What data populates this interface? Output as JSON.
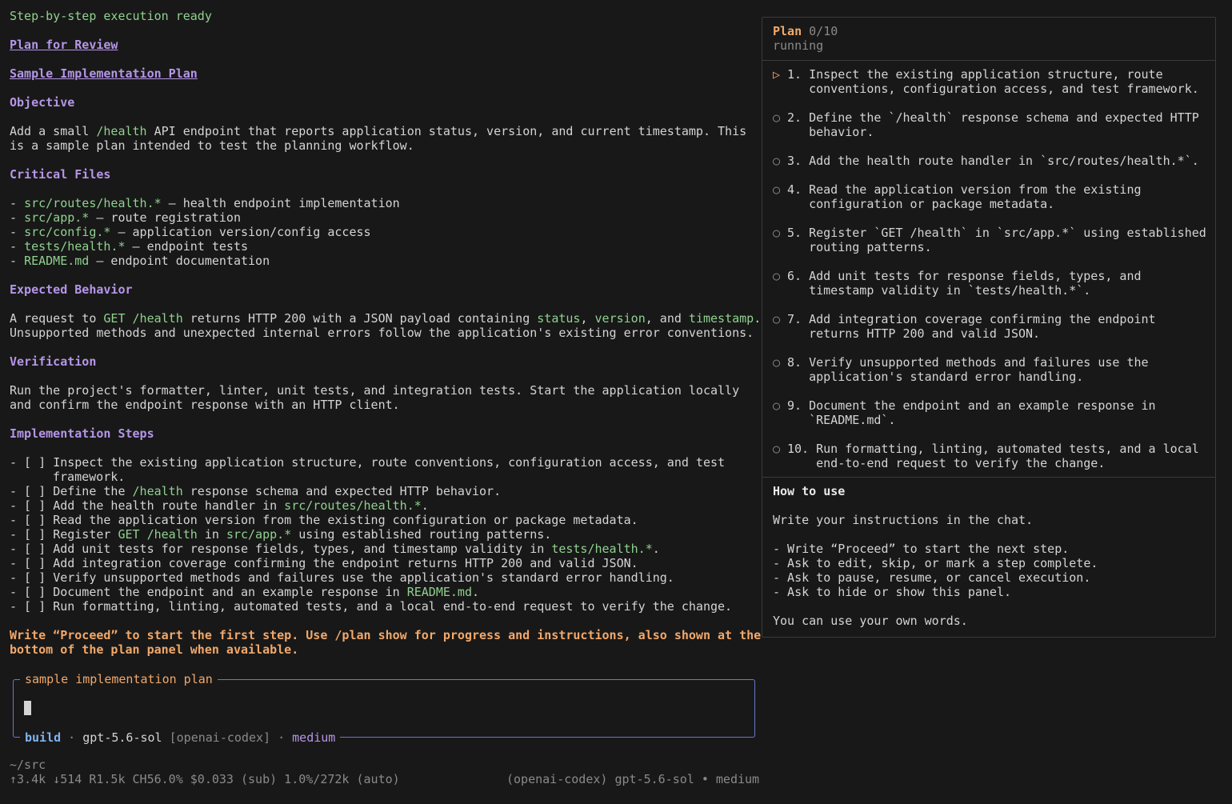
{
  "main": {
    "status_line": "Step-by-step execution ready",
    "plan_for_review": "Plan for Review",
    "plan_title": "Sample Implementation Plan",
    "objective_heading": "Objective",
    "objective_line1_a": "Add a small ",
    "objective_line1_code": "/health",
    "objective_line1_b": " API endpoint that reports application status, version, and current timestamp. This",
    "objective_line2": "is a sample plan intended to test the planning workflow.",
    "critical_heading": "Critical Files",
    "files": [
      {
        "path": "src/routes/health.*",
        "desc": " — health endpoint implementation"
      },
      {
        "path": "src/app.*",
        "desc": " — route registration"
      },
      {
        "path": "src/config.*",
        "desc": " — application version/config access"
      },
      {
        "path": "tests/health.*",
        "desc": " — endpoint tests"
      },
      {
        "path": "README.md",
        "desc": " — endpoint documentation"
      }
    ],
    "expected_heading": "Expected Behavior",
    "expected_line1": {
      "a": "A request to ",
      "b": "GET /health",
      "c": " returns HTTP 200 with a JSON payload containing ",
      "d": "status",
      "e": ", ",
      "f": "version",
      "g": ", and ",
      "h": "timestamp",
      "i": "."
    },
    "expected_line2": "Unsupported methods and unexpected internal errors follow the application's existing error conventions.",
    "verification_heading": "Verification",
    "verification_line1": "Run the project's formatter, linter, unit tests, and integration tests. Start the application locally",
    "verification_line2": "and confirm the endpoint response with an HTTP client.",
    "impl_heading": "Implementation Steps",
    "checkbox_prefix": "- [ ] ",
    "impl_steps": {
      "s1a": "Inspect the existing application structure, route conventions, configuration access, and test",
      "s1b": "framework.",
      "s2a": "Define the ",
      "s2b": "/health",
      "s2c": " response schema and expected HTTP behavior.",
      "s3a": "Add the health route handler in ",
      "s3b": "src/routes/health.*",
      "s3c": ".",
      "s4": "Read the application version from the existing configuration or package metadata.",
      "s5a": "Register ",
      "s5b": "GET /health",
      "s5c": " in ",
      "s5d": "src/app.*",
      "s5e": " using established routing patterns.",
      "s6a": "Add unit tests for response fields, types, and timestamp validity in ",
      "s6b": "tests/health.*",
      "s6c": ".",
      "s7": "Add integration coverage confirming the endpoint returns HTTP 200 and valid JSON.",
      "s8": "Verify unsupported methods and failures use the application's standard error handling.",
      "s9a": "Document the endpoint and an example response in ",
      "s9b": "README.md",
      "s9c": ".",
      "s10": "Run formatting, linting, automated tests, and a local end-to-end request to verify the change."
    },
    "instruction_line1": "Write “Proceed” to start the first step. Use /plan show for progress and instructions, also shown at the",
    "instruction_line2": "bottom of the plan panel when available."
  },
  "input": {
    "title": "sample implementation plan",
    "mode": "build",
    "sep": " · ",
    "model": "gpt-5.6-sol",
    "provider": " [openai-codex]",
    "effort": "medium"
  },
  "status": {
    "cwd": "~/src",
    "usage": "↑3.4k ↓514 R1.5k CH56.0% $0.033 (sub) 1.0%/272k (auto)",
    "model_info": "(openai-codex) gpt-5.6-sol • medium"
  },
  "panel": {
    "title": "Plan",
    "count": " 0/10",
    "state": "running",
    "active_marker": "▷",
    "pending_marker": "○",
    "steps": [
      {
        "num": "1. ",
        "text": "Inspect the existing application structure, route conventions, configuration access, and test framework."
      },
      {
        "num": "2. ",
        "text": "Define the `/health` response schema and expected HTTP behavior."
      },
      {
        "num": "3. ",
        "text": "Add the health route handler in `src/routes/health.*`."
      },
      {
        "num": "4. ",
        "text": "Read the application version from the existing configuration or package metadata."
      },
      {
        "num": "5. ",
        "text": "Register `GET /health` in `src/app.*` using established routing patterns."
      },
      {
        "num": "6. ",
        "text": "Add unit tests for response fields, types, and timestamp validity in `tests/health.*`."
      },
      {
        "num": "7. ",
        "text": "Add integration coverage confirming the endpoint returns HTTP 200 and valid JSON."
      },
      {
        "num": "8. ",
        "text": "Verify unsupported methods and failures use the application's standard error handling."
      },
      {
        "num": "9. ",
        "text": "Document the endpoint and an example response in `README.md`."
      },
      {
        "num": "10. ",
        "text": "Run formatting, linting, automated tests, and a local end-to-end request to verify the change."
      }
    ],
    "howto_heading": "How to use",
    "howto_intro": "Write your instructions in the chat.",
    "howto_items": [
      "- Write “Proceed” to start the next step.",
      "- Ask to edit, skip, or mark a step complete.",
      "- Ask to pause, resume, or cancel execution.",
      "- Ask to hide or show this panel."
    ],
    "howto_outro": "You can use your own words."
  },
  "colors": {
    "accent_green": "#8fd18f",
    "accent_purple": "#b596e8",
    "accent_orange": "#f2a86a",
    "accent_blue": "#7fb3f0"
  }
}
